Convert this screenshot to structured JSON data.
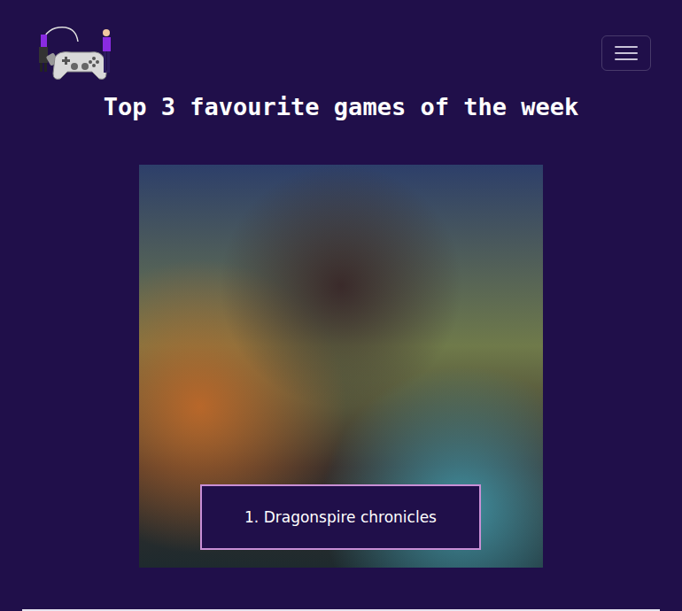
{
  "page": {
    "title": "Top 3 favourite games of the week"
  },
  "carousel": {
    "caption": "1. Dragonspire chronicles"
  }
}
